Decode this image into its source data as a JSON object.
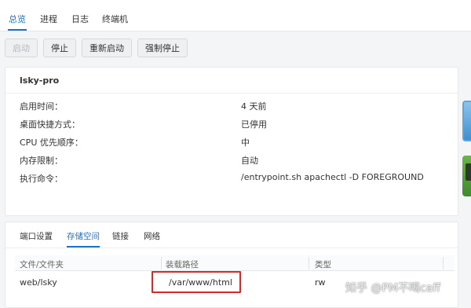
{
  "nav": {
    "tabs": [
      {
        "label": "总览"
      },
      {
        "label": "进程"
      },
      {
        "label": "日志"
      },
      {
        "label": "终端机"
      }
    ]
  },
  "toolbar": {
    "start_label": "启动",
    "stop_label": "停止",
    "restart_label": "重新启动",
    "force_stop_label": "强制停止"
  },
  "container": {
    "name": "lsky-pro",
    "fields": [
      {
        "label": "启用时间：",
        "value": "4 天前"
      },
      {
        "label": "桌面快捷方式：",
        "value": "已停用"
      },
      {
        "label": "CPU 优先顺序：",
        "value": "中"
      },
      {
        "label": "内存限制：",
        "value": "自动"
      },
      {
        "label": "执行命令：",
        "value": "/entrypoint.sh apachectl -D FOREGROUND"
      }
    ]
  },
  "subtabs": [
    {
      "label": "端口设置"
    },
    {
      "label": "存储空间"
    },
    {
      "label": "链接"
    },
    {
      "label": "网络"
    }
  ],
  "volume_table": {
    "headers": [
      "文件/文件夹",
      "装载路径",
      "类型"
    ],
    "rows": [
      {
        "folder": "web/lsky",
        "mount": "/var/www/html",
        "type": "rw"
      }
    ]
  },
  "watermark": "知乎 @PM不喝caff",
  "colors": {
    "accent": "#1a73c7",
    "highlight": "#d42a2a"
  }
}
